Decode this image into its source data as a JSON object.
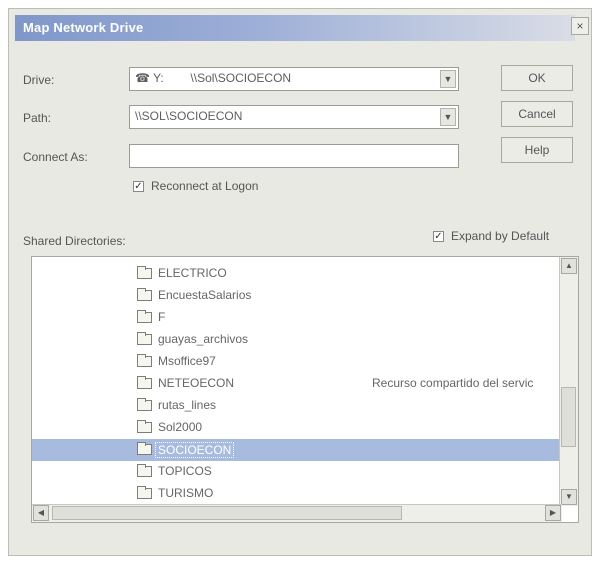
{
  "dialog": {
    "title": "Map Network Drive",
    "close_label": "×"
  },
  "form": {
    "drive_label": "Drive:",
    "drive_value": "☎ Y:        \\\\Sol\\SOCIOECON",
    "path_label": "Path:",
    "path_value": "\\\\SOL\\SOCIOECON",
    "connect_as_label": "Connect As:",
    "connect_as_value": "",
    "reconnect_label": "Reconnect at Logon",
    "reconnect_checked": true,
    "shared_dirs_label": "Shared Directories:",
    "expand_label": "Expand by Default",
    "expand_checked": true
  },
  "buttons": {
    "ok": "OK",
    "cancel": "Cancel",
    "help": "Help"
  },
  "shared_directories": [
    {
      "name": "ELECTRICO",
      "comment": ""
    },
    {
      "name": "EncuestaSalarios",
      "comment": ""
    },
    {
      "name": "F",
      "comment": ""
    },
    {
      "name": "guayas_archivos",
      "comment": ""
    },
    {
      "name": "Msoffice97",
      "comment": ""
    },
    {
      "name": "NETEOECON",
      "comment": "Recurso compartido del servic"
    },
    {
      "name": "rutas_lines",
      "comment": ""
    },
    {
      "name": "Sol2000",
      "comment": ""
    },
    {
      "name": "SOCIOECON",
      "comment": "",
      "selected": true
    },
    {
      "name": "TOPICOS",
      "comment": ""
    },
    {
      "name": "TURISMO",
      "comment": ""
    }
  ],
  "icons": {
    "share": "shared-folder-icon",
    "dropdown": "chevron-down-icon",
    "scroll_up": "arrow-up-icon",
    "scroll_down": "arrow-down-icon",
    "scroll_left": "arrow-left-icon",
    "scroll_right": "arrow-right-icon"
  },
  "colors": {
    "title_bar": "#7f97c9",
    "selection": "#a7bbdf",
    "dialog_bg": "#e9e9e4"
  }
}
